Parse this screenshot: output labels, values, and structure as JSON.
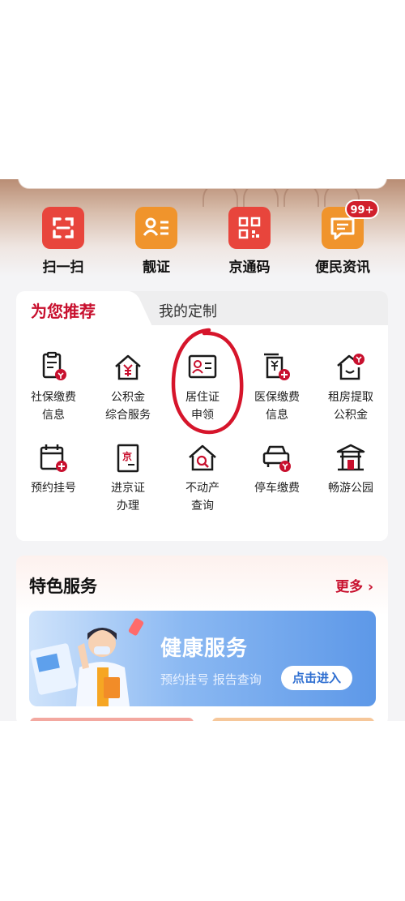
{
  "search": {
    "placeholder_text": ""
  },
  "quick_actions": [
    {
      "label": "扫一扫",
      "icon": "scan-icon",
      "color": "#e8453c"
    },
    {
      "label": "靓证",
      "icon": "id-card-icon",
      "color": "#f0942c"
    },
    {
      "label": "京通码",
      "icon": "qr-code-icon",
      "color": "#e8453c"
    },
    {
      "label": "便民资讯",
      "icon": "message-icon",
      "color": "#f0942c",
      "badge": "99+"
    }
  ],
  "tabs": [
    {
      "label": "为您推荐",
      "active": true
    },
    {
      "label": "我的定制",
      "active": false
    }
  ],
  "services": [
    {
      "label": "社保缴费\n信息",
      "icon": "social-security-icon"
    },
    {
      "label": "公积金\n综合服务",
      "icon": "housing-fund-icon"
    },
    {
      "label": "居住证\n申领",
      "icon": "residence-permit-icon",
      "highlighted": true
    },
    {
      "label": "医保缴费\n信息",
      "icon": "medical-insurance-icon"
    },
    {
      "label": "租房提取\n公积金",
      "icon": "rent-withdrawal-icon"
    },
    {
      "label": "预约挂号",
      "icon": "appointment-icon"
    },
    {
      "label": "进京证\n办理",
      "icon": "beijing-entry-permit-icon"
    },
    {
      "label": "不动产\n查询",
      "icon": "real-estate-icon"
    },
    {
      "label": "停车缴费",
      "icon": "parking-icon"
    },
    {
      "label": "畅游公园",
      "icon": "park-icon"
    }
  ],
  "featured": {
    "title": "特色服务",
    "more_label": "更多",
    "banner": {
      "title": "健康服务",
      "subtitle": "预约挂号 报告查询",
      "button_label": "点击进入"
    }
  },
  "colors": {
    "accent": "#c8102e",
    "highlight_circle": "#d6152b",
    "icon_ink": "#1a1a1a"
  }
}
